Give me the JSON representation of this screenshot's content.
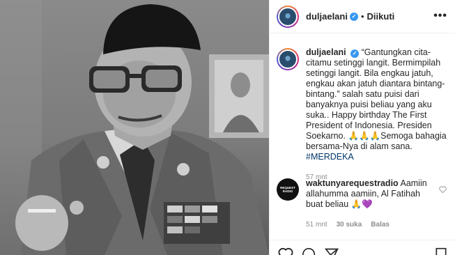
{
  "post": {
    "username": "duljaelani",
    "separator": "•",
    "follow_state": "Diikuti",
    "more_icon": "more-icon"
  },
  "caption": {
    "username": "duljaelani",
    "text": "“Gantungkan cita-citamu setinggi langit. Bermimpilah setinggi langit. Bila engkau jatuh, engkau akan jatuh diantara bintang-bintang.” salah satu puisi dari banyaknya puisi beliau yang aku suka.. Happy birthday The First President of Indonesia. Presiden Soekarno. 🙏🙏🙏Semoga bahagia bersama-Nya di alam sana.",
    "hashtag": "#MERDEKA",
    "time": "57 mnt"
  },
  "comment": {
    "avatar_line1": "REQUEST",
    "avatar_line2": "RADIO",
    "username": "waktunyarequestradio",
    "text": "Aamiin allahumma aamiin, Al Fatihah buat beliau 🙏💜",
    "time": "51 mnt",
    "likes": "30 suka",
    "reply": "Balas"
  },
  "colors": {
    "verified": "#3897f0",
    "hashtag": "#00376b",
    "muted": "#8e8e8e"
  },
  "icons": [
    "verified-badge-icon",
    "heart-icon",
    "comment-icon",
    "share-icon",
    "bookmark-icon"
  ]
}
